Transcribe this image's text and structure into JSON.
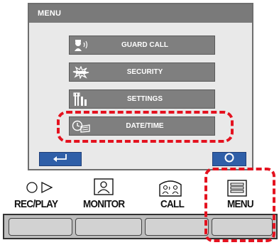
{
  "screen": {
    "title": "MENU",
    "items": [
      {
        "label": "GUARD CALL",
        "icon": "guard-call-icon"
      },
      {
        "label": "SECURITY",
        "icon": "security-icon"
      },
      {
        "label": "SETTINGS",
        "icon": "settings-icon"
      },
      {
        "label": "DATE/TIME",
        "icon": "clock-calendar-icon"
      }
    ],
    "buttons": {
      "back": "back-arrow-icon",
      "select": "circle-icon"
    }
  },
  "hardware": {
    "labels": {
      "rec_play": "REC/PLAY",
      "monitor": "MONITOR",
      "call": "CALL",
      "menu": "MENU"
    }
  },
  "colors": {
    "highlight": "#e4121f",
    "menu_item": "#7f7f7f",
    "screen_button": "#2f5fa8",
    "header": "#7a7a7a"
  }
}
